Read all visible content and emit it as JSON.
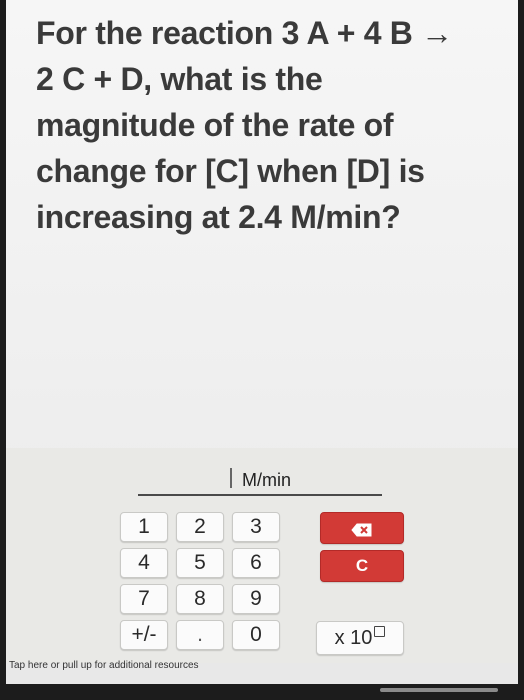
{
  "question": {
    "lines": [
      "For the reaction 3 A + 4 B →",
      "2 C + D, what is the",
      "magnitude of the rate of",
      "change for [C] when [D] is",
      "increasing at 2.4 M/min?"
    ]
  },
  "answer": {
    "value": "",
    "unit": "M/min"
  },
  "keypad": {
    "keys": [
      "1",
      "2",
      "3",
      "4",
      "5",
      "6",
      "7",
      "8",
      "9",
      "+/-",
      ".",
      "0"
    ],
    "clear_label": "C",
    "sci_label": "x 10",
    "backspace_icon": "backspace-icon"
  },
  "footer": {
    "hint": "Tap here or pull up for additional resources"
  },
  "colors": {
    "action_red": "#d23a36",
    "text": "#3a3a3a"
  }
}
